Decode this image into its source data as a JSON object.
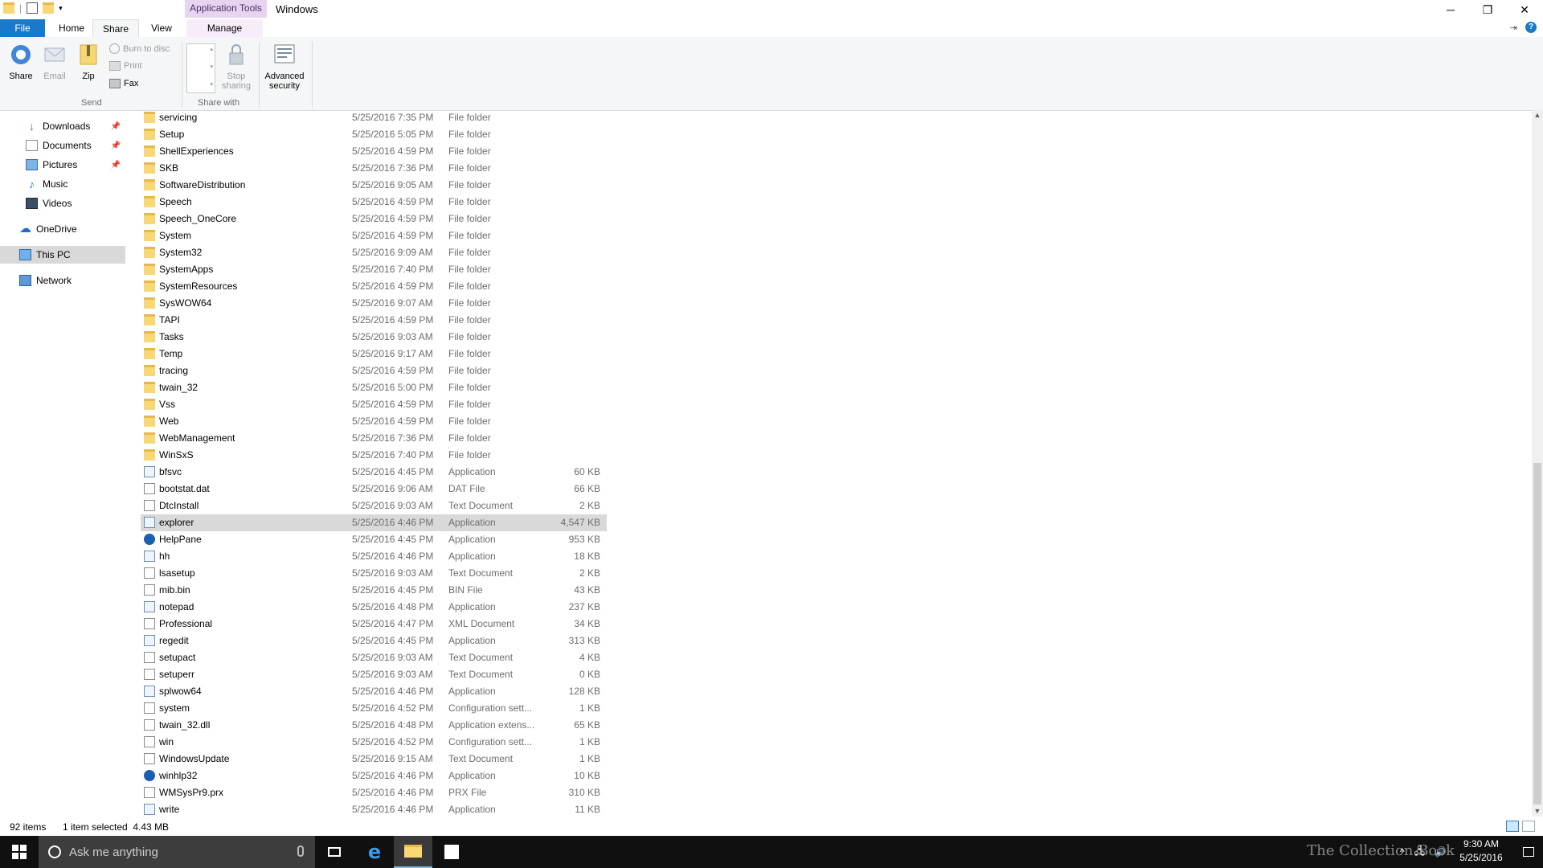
{
  "window": {
    "title": "Windows",
    "contextual_tab_group": "Application Tools",
    "controls": [
      "minimize",
      "restore",
      "close"
    ]
  },
  "ribbon_tabs": {
    "file": "File",
    "home": "Home",
    "share": "Share",
    "view": "View",
    "manage": "Manage"
  },
  "ribbon": {
    "share_label": "Share",
    "email_label": "Email",
    "zip_label": "Zip",
    "burn_label": "Burn to disc",
    "print_label": "Print",
    "fax_label": "Fax",
    "send_group": "Send",
    "stop_sharing_line1": "Stop",
    "stop_sharing_line2": "sharing",
    "advanced_line1": "Advanced",
    "advanced_line2": "security",
    "share_with_group": "Share with"
  },
  "nav": {
    "items": [
      {
        "label": "Downloads",
        "pinned": true,
        "icon": "download-arrow-icon"
      },
      {
        "label": "Documents",
        "pinned": true,
        "icon": "documents-icon"
      },
      {
        "label": "Pictures",
        "pinned": true,
        "icon": "pictures-icon"
      },
      {
        "label": "Music",
        "pinned": false,
        "icon": "music-note-icon"
      },
      {
        "label": "Videos",
        "pinned": false,
        "icon": "film-icon"
      },
      {
        "label": "OneDrive",
        "pinned": false,
        "icon": "cloud-icon"
      },
      {
        "label": "This PC",
        "pinned": false,
        "icon": "monitor-icon"
      },
      {
        "label": "Network",
        "pinned": false,
        "icon": "network-icon"
      }
    ],
    "pin_glyph": "📌"
  },
  "files": [
    {
      "name": "servicing",
      "date": "5/25/2016 7:35 PM",
      "type": "File folder",
      "size": "",
      "kind": "folder"
    },
    {
      "name": "Setup",
      "date": "5/25/2016 5:05 PM",
      "type": "File folder",
      "size": "",
      "kind": "folder"
    },
    {
      "name": "ShellExperiences",
      "date": "5/25/2016 4:59 PM",
      "type": "File folder",
      "size": "",
      "kind": "folder"
    },
    {
      "name": "SKB",
      "date": "5/25/2016 7:36 PM",
      "type": "File folder",
      "size": "",
      "kind": "folder"
    },
    {
      "name": "SoftwareDistribution",
      "date": "5/25/2016 9:05 AM",
      "type": "File folder",
      "size": "",
      "kind": "folder"
    },
    {
      "name": "Speech",
      "date": "5/25/2016 4:59 PM",
      "type": "File folder",
      "size": "",
      "kind": "folder"
    },
    {
      "name": "Speech_OneCore",
      "date": "5/25/2016 4:59 PM",
      "type": "File folder",
      "size": "",
      "kind": "folder"
    },
    {
      "name": "System",
      "date": "5/25/2016 4:59 PM",
      "type": "File folder",
      "size": "",
      "kind": "folder"
    },
    {
      "name": "System32",
      "date": "5/25/2016 9:09 AM",
      "type": "File folder",
      "size": "",
      "kind": "folder"
    },
    {
      "name": "SystemApps",
      "date": "5/25/2016 7:40 PM",
      "type": "File folder",
      "size": "",
      "kind": "folder"
    },
    {
      "name": "SystemResources",
      "date": "5/25/2016 4:59 PM",
      "type": "File folder",
      "size": "",
      "kind": "folder"
    },
    {
      "name": "SysWOW64",
      "date": "5/25/2016 9:07 AM",
      "type": "File folder",
      "size": "",
      "kind": "folder"
    },
    {
      "name": "TAPI",
      "date": "5/25/2016 4:59 PM",
      "type": "File folder",
      "size": "",
      "kind": "folder"
    },
    {
      "name": "Tasks",
      "date": "5/25/2016 9:03 AM",
      "type": "File folder",
      "size": "",
      "kind": "folder"
    },
    {
      "name": "Temp",
      "date": "5/25/2016 9:17 AM",
      "type": "File folder",
      "size": "",
      "kind": "folder"
    },
    {
      "name": "tracing",
      "date": "5/25/2016 4:59 PM",
      "type": "File folder",
      "size": "",
      "kind": "folder"
    },
    {
      "name": "twain_32",
      "date": "5/25/2016 5:00 PM",
      "type": "File folder",
      "size": "",
      "kind": "folder"
    },
    {
      "name": "Vss",
      "date": "5/25/2016 4:59 PM",
      "type": "File folder",
      "size": "",
      "kind": "folder"
    },
    {
      "name": "Web",
      "date": "5/25/2016 4:59 PM",
      "type": "File folder",
      "size": "",
      "kind": "folder"
    },
    {
      "name": "WebManagement",
      "date": "5/25/2016 7:36 PM",
      "type": "File folder",
      "size": "",
      "kind": "folder"
    },
    {
      "name": "WinSxS",
      "date": "5/25/2016 7:40 PM",
      "type": "File folder",
      "size": "",
      "kind": "folder"
    },
    {
      "name": "bfsvc",
      "date": "5/25/2016 4:45 PM",
      "type": "Application",
      "size": "60 KB",
      "kind": "app"
    },
    {
      "name": "bootstat.dat",
      "date": "5/25/2016 9:06 AM",
      "type": "DAT File",
      "size": "66 KB",
      "kind": "doc"
    },
    {
      "name": "DtcInstall",
      "date": "5/25/2016 9:03 AM",
      "type": "Text Document",
      "size": "2 KB",
      "kind": "doc"
    },
    {
      "name": "explorer",
      "date": "5/25/2016 4:46 PM",
      "type": "Application",
      "size": "4,547 KB",
      "kind": "app",
      "selected": true
    },
    {
      "name": "HelpPane",
      "date": "5/25/2016 4:45 PM",
      "type": "Application",
      "size": "953 KB",
      "kind": "help"
    },
    {
      "name": "hh",
      "date": "5/25/2016 4:46 PM",
      "type": "Application",
      "size": "18 KB",
      "kind": "app"
    },
    {
      "name": "lsasetup",
      "date": "5/25/2016 9:03 AM",
      "type": "Text Document",
      "size": "2 KB",
      "kind": "doc"
    },
    {
      "name": "mib.bin",
      "date": "5/25/2016 4:45 PM",
      "type": "BIN File",
      "size": "43 KB",
      "kind": "doc"
    },
    {
      "name": "notepad",
      "date": "5/25/2016 4:48 PM",
      "type": "Application",
      "size": "237 KB",
      "kind": "app"
    },
    {
      "name": "Professional",
      "date": "5/25/2016 4:47 PM",
      "type": "XML Document",
      "size": "34 KB",
      "kind": "doc"
    },
    {
      "name": "regedit",
      "date": "5/25/2016 4:45 PM",
      "type": "Application",
      "size": "313 KB",
      "kind": "app"
    },
    {
      "name": "setupact",
      "date": "5/25/2016 9:03 AM",
      "type": "Text Document",
      "size": "4 KB",
      "kind": "doc"
    },
    {
      "name": "setuperr",
      "date": "5/25/2016 9:03 AM",
      "type": "Text Document",
      "size": "0 KB",
      "kind": "doc"
    },
    {
      "name": "splwow64",
      "date": "5/25/2016 4:46 PM",
      "type": "Application",
      "size": "128 KB",
      "kind": "app"
    },
    {
      "name": "system",
      "date": "5/25/2016 4:52 PM",
      "type": "Configuration sett...",
      "size": "1 KB",
      "kind": "doc"
    },
    {
      "name": "twain_32.dll",
      "date": "5/25/2016 4:48 PM",
      "type": "Application extens...",
      "size": "65 KB",
      "kind": "doc"
    },
    {
      "name": "win",
      "date": "5/25/2016 4:52 PM",
      "type": "Configuration sett...",
      "size": "1 KB",
      "kind": "doc"
    },
    {
      "name": "WindowsUpdate",
      "date": "5/25/2016 9:15 AM",
      "type": "Text Document",
      "size": "1 KB",
      "kind": "doc"
    },
    {
      "name": "winhlp32",
      "date": "5/25/2016 4:46 PM",
      "type": "Application",
      "size": "10 KB",
      "kind": "help"
    },
    {
      "name": "WMSysPr9.prx",
      "date": "5/25/2016 4:46 PM",
      "type": "PRX File",
      "size": "310 KB",
      "kind": "doc"
    },
    {
      "name": "write",
      "date": "5/25/2016 4:46 PM",
      "type": "Application",
      "size": "11 KB",
      "kind": "app"
    }
  ],
  "status": {
    "item_count": "92 items",
    "selection": "1 item selected  4.43 MB"
  },
  "taskbar": {
    "search_placeholder": "Ask me anything",
    "time": "9:30 AM",
    "date": "5/25/2016",
    "watermark": "The Collection Book"
  },
  "colors": {
    "accent": "#1979ca",
    "selection_row": "#d9d9d9",
    "nav_selected": "#cce8ff",
    "folder": "#f8d775",
    "taskbar": "#101010"
  }
}
